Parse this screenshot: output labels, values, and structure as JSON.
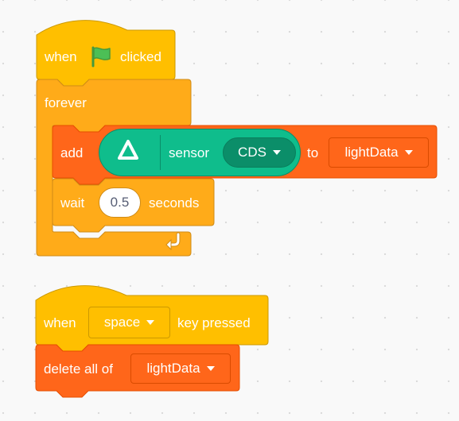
{
  "colors": {
    "events": "#ffbf00",
    "events_border": "#cc9900",
    "control": "#ffab19",
    "control_border": "#cf8b17",
    "data_list": "#ff661a",
    "data_list_border": "#e64d00",
    "extension": "#0fbd8c",
    "extension_border": "#0b8e69",
    "extension_dropdown": "#0b8e69"
  },
  "script1": {
    "hat_when": "when",
    "hat_flag_icon": "green-flag-icon",
    "hat_clicked": "clicked",
    "forever_label": "forever",
    "forever_arrow_icon": "loop-arrow-icon",
    "add_label": "add",
    "sensor_icon": "sensor-extension-icon",
    "sensor_label": "sensor",
    "sensor_value": "CDS",
    "to_label": "to",
    "list_value": "lightData",
    "wait_label": "wait",
    "wait_value": "0.5",
    "seconds_label": "seconds"
  },
  "script2": {
    "hat_when": "when",
    "key_value": "space",
    "key_pressed": "key pressed",
    "delete_label": "delete all of",
    "list_value": "lightData"
  }
}
